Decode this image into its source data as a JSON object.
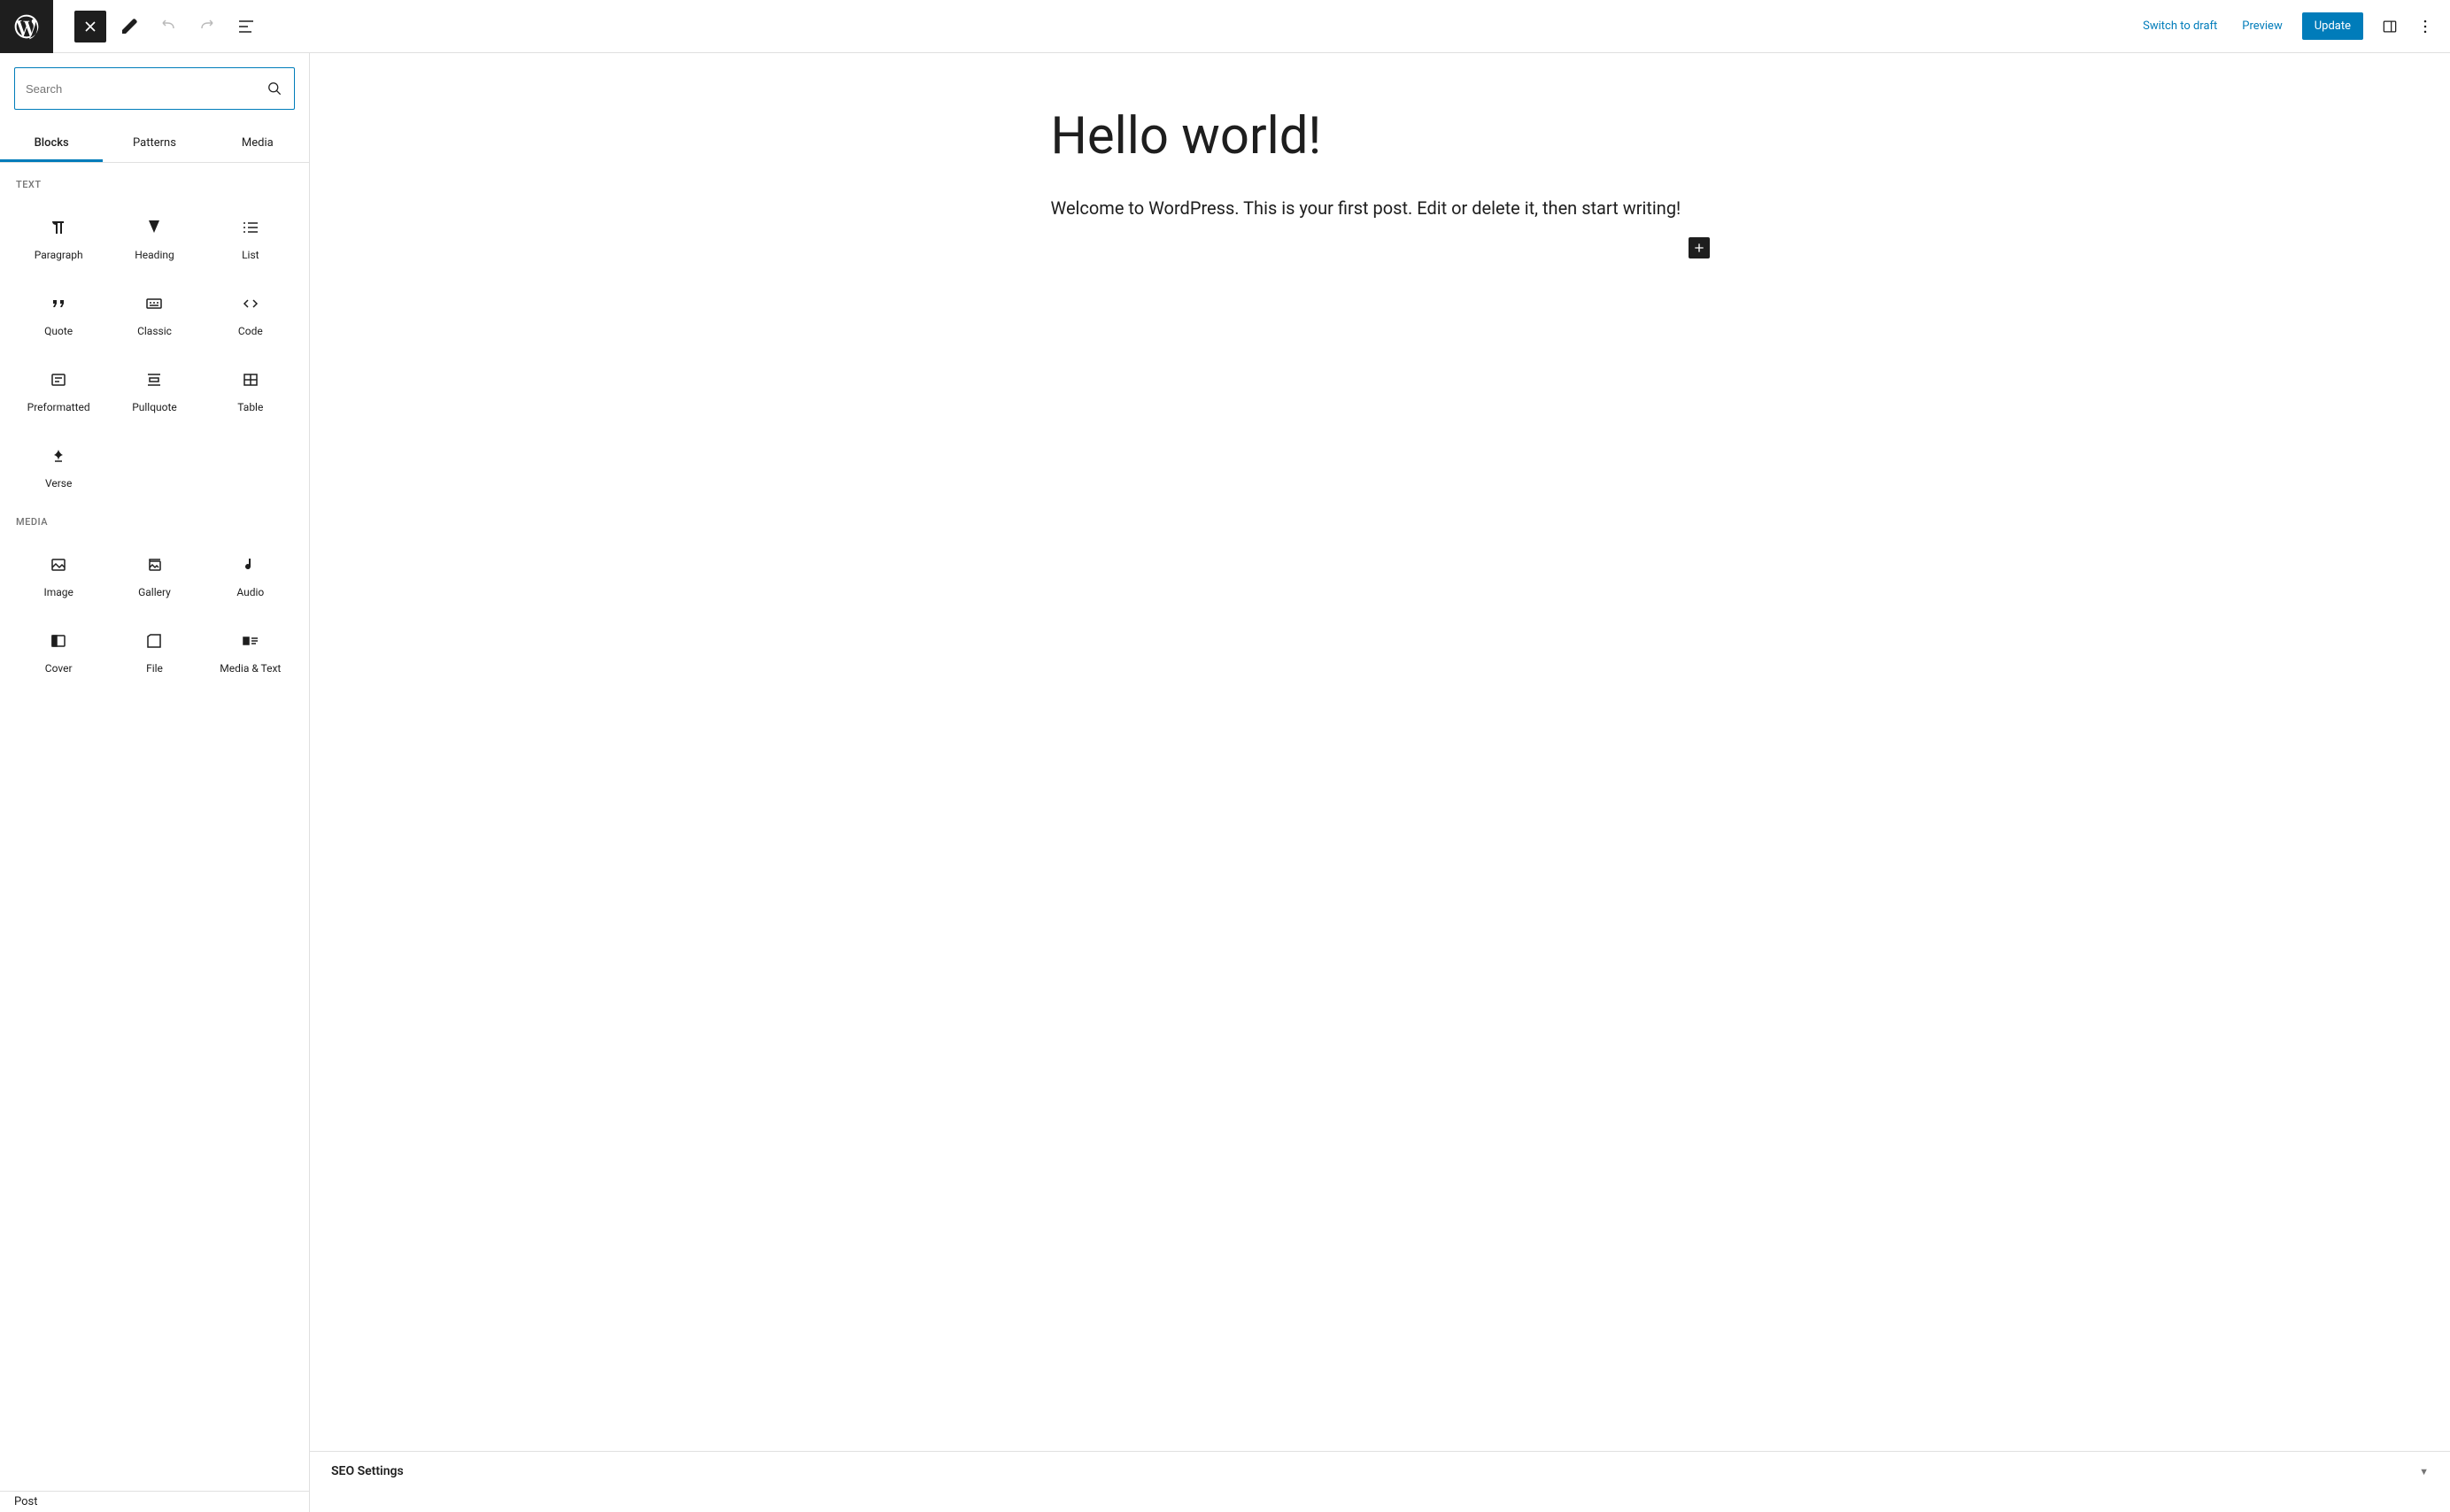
{
  "header": {
    "switch_draft": "Switch to draft",
    "preview": "Preview",
    "update": "Update"
  },
  "inserter": {
    "search_placeholder": "Search",
    "tabs": {
      "blocks": "Blocks",
      "patterns": "Patterns",
      "media": "Media"
    },
    "categories": {
      "text": "TEXT",
      "media": "MEDIA"
    },
    "blocks": {
      "paragraph": "Paragraph",
      "heading": "Heading",
      "list": "List",
      "quote": "Quote",
      "classic": "Classic",
      "code": "Code",
      "preformatted": "Preformatted",
      "pullquote": "Pullquote",
      "table": "Table",
      "verse": "Verse",
      "image": "Image",
      "gallery": "Gallery",
      "audio": "Audio",
      "cover": "Cover",
      "file": "File",
      "media_text": "Media & Text"
    }
  },
  "post": {
    "title": "Hello world!",
    "body": "Welcome to WordPress. This is your first post. Edit or delete it, then start writing!"
  },
  "breadcrumb": "Post",
  "bottom_panel": {
    "title": "SEO Settings"
  }
}
